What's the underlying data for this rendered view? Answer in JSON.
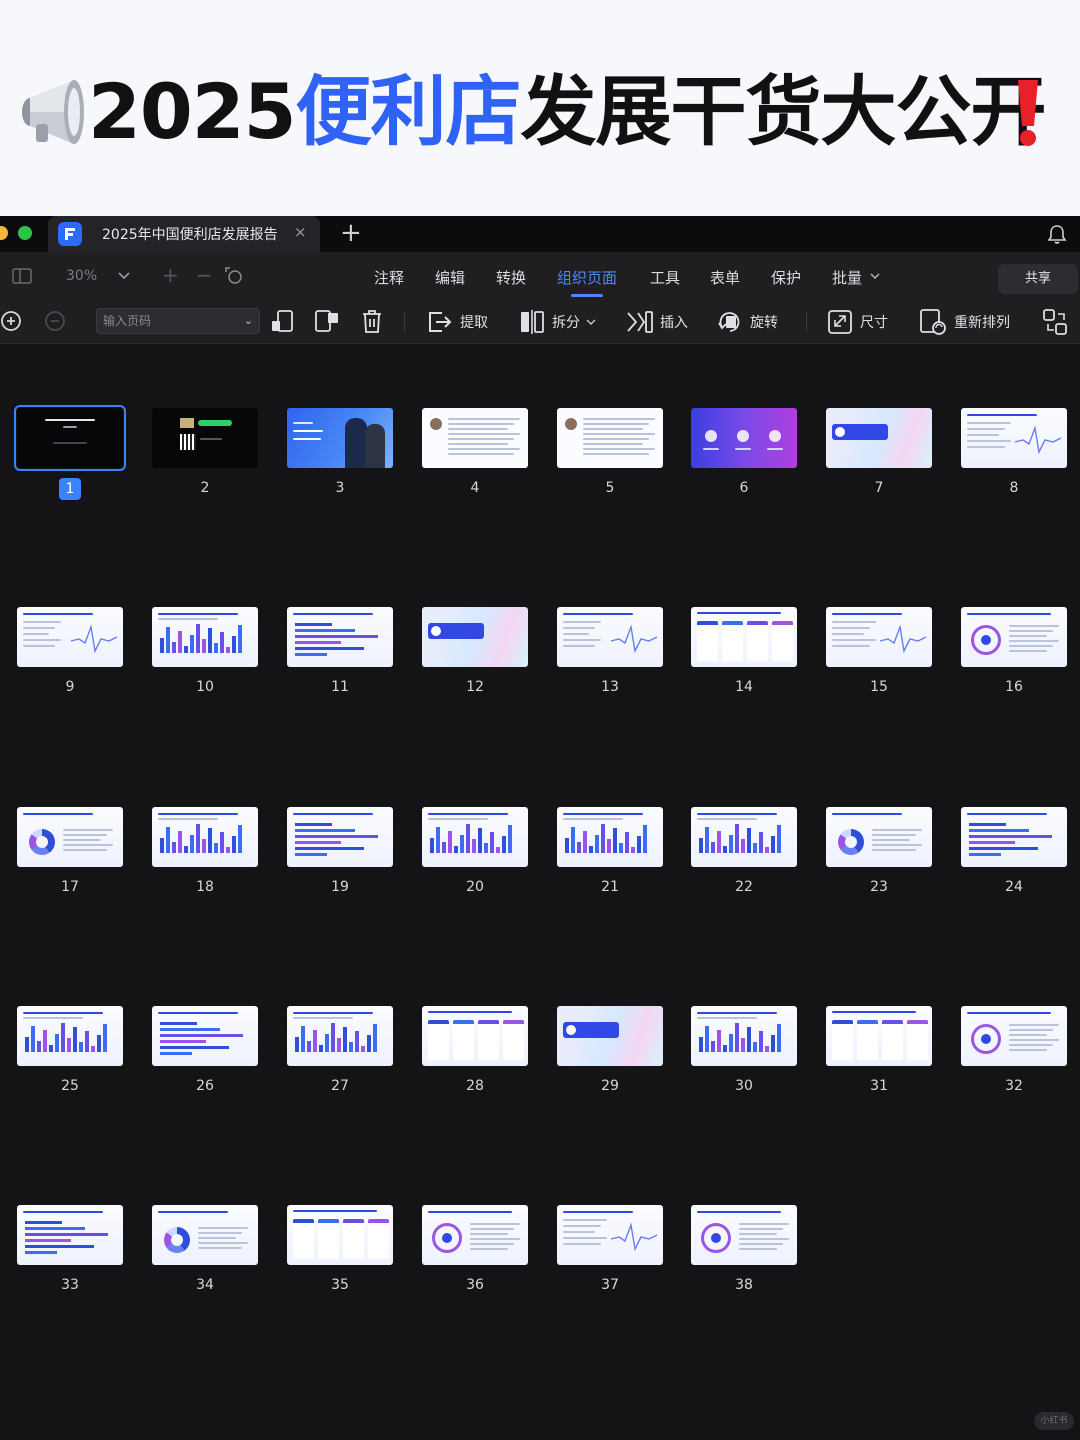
{
  "banner": {
    "title_prefix": "2025",
    "title_highlight": "便利店",
    "title_suffix": "发展干货大公开",
    "icon": "megaphone-icon",
    "end_icon": "exclamation-icon"
  },
  "window": {
    "tab_title": "2025年中国便利店发展报告",
    "tab_close": "×",
    "new_tab": "+",
    "colors": {
      "accent": "#4f86ff",
      "background": "#141416"
    }
  },
  "menubar": {
    "zoom": "30%",
    "items": [
      "注释",
      "编辑",
      "转换",
      "组织页面",
      "工具",
      "表单",
      "保护",
      "批量"
    ],
    "active": "组织页面",
    "share": "共享"
  },
  "toolbar": {
    "page_input_placeholder": "输入页码",
    "extract": "提取",
    "split": "拆分",
    "insert": "插入",
    "rotate": "旋转",
    "size": "尺寸",
    "reorder": "重新排列"
  },
  "pages": [
    {
      "n": "1",
      "style": "dark-title",
      "selected": true
    },
    {
      "n": "2",
      "style": "dark-qr"
    },
    {
      "n": "3",
      "style": "blue-cover"
    },
    {
      "n": "4",
      "style": "text-portrait"
    },
    {
      "n": "5",
      "style": "text-portrait"
    },
    {
      "n": "6",
      "style": "toc"
    },
    {
      "n": "7",
      "style": "section"
    },
    {
      "n": "8",
      "style": "text-chart"
    },
    {
      "n": "9",
      "style": "line-chart"
    },
    {
      "n": "10",
      "style": "bar-chart"
    },
    {
      "n": "11",
      "style": "hbar-chart"
    },
    {
      "n": "12",
      "style": "section"
    },
    {
      "n": "13",
      "style": "line-chart"
    },
    {
      "n": "14",
      "style": "cards"
    },
    {
      "n": "15",
      "style": "text-chart"
    },
    {
      "n": "16",
      "style": "diagram"
    },
    {
      "n": "17",
      "style": "donut"
    },
    {
      "n": "18",
      "style": "bar-chart"
    },
    {
      "n": "19",
      "style": "hbar-chart"
    },
    {
      "n": "20",
      "style": "bar-chart"
    },
    {
      "n": "21",
      "style": "bar-chart"
    },
    {
      "n": "22",
      "style": "bar-chart"
    },
    {
      "n": "23",
      "style": "donut"
    },
    {
      "n": "24",
      "style": "hbar-chart"
    },
    {
      "n": "25",
      "style": "bar-chart"
    },
    {
      "n": "26",
      "style": "hbar-chart"
    },
    {
      "n": "27",
      "style": "bar-chart"
    },
    {
      "n": "28",
      "style": "cards"
    },
    {
      "n": "29",
      "style": "section"
    },
    {
      "n": "30",
      "style": "bar-chart"
    },
    {
      "n": "31",
      "style": "cards"
    },
    {
      "n": "32",
      "style": "diagram"
    },
    {
      "n": "33",
      "style": "hbar-chart"
    },
    {
      "n": "34",
      "style": "donut"
    },
    {
      "n": "35",
      "style": "cards"
    },
    {
      "n": "36",
      "style": "diagram"
    },
    {
      "n": "37",
      "style": "text-chart"
    },
    {
      "n": "38",
      "style": "diagram"
    }
  ],
  "watermark": "小红书"
}
